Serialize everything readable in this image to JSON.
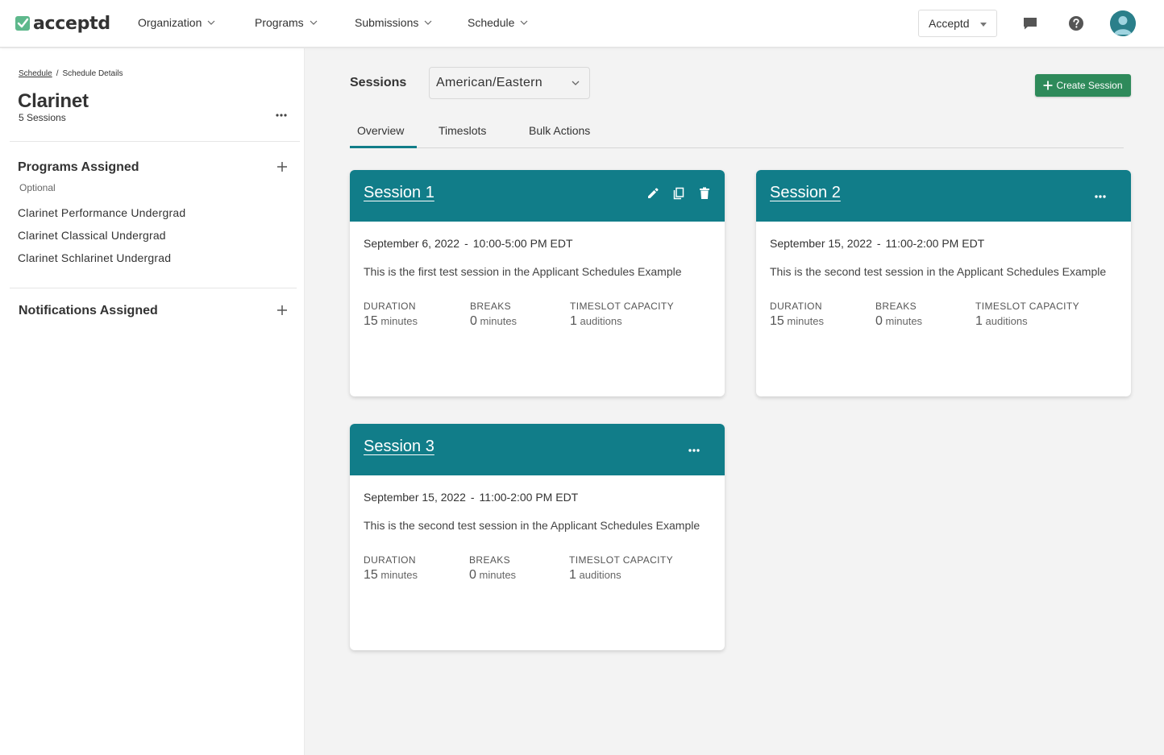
{
  "app": {
    "logo_text": "acceptd"
  },
  "nav": {
    "items": [
      {
        "label": "Organization"
      },
      {
        "label": "Programs"
      },
      {
        "label": "Submissions"
      },
      {
        "label": "Schedule"
      }
    ],
    "org_select": "Acceptd",
    "icons": [
      "chat-icon",
      "help-icon",
      "user-avatar-icon"
    ]
  },
  "sidebar": {
    "breadcrumb": {
      "link": "Schedule",
      "separator": "/",
      "current": "Schedule Details"
    },
    "title": "Clarinet",
    "subtitle": "5 Sessions",
    "programs": {
      "title": "Programs Assigned",
      "optional": "Optional",
      "items": [
        "Clarinet Performance Undergrad",
        "Clarinet Classical Undergrad",
        "Clarinet Schlarinet Undergrad"
      ]
    },
    "notifications": {
      "title": "Notifications Assigned"
    }
  },
  "main": {
    "sessions_label": "Sessions",
    "timezone": "American/Eastern",
    "create_button": "Create Session",
    "tabs": [
      {
        "label": "Overview",
        "active": true
      },
      {
        "label": "Timeslots",
        "active": false
      },
      {
        "label": "Bulk Actions",
        "active": false
      }
    ],
    "cards": [
      {
        "title": "Session 1",
        "date": "September 6, 2022",
        "separator": "-",
        "time": "10:00-5:00 PM EDT",
        "description": "This is the first test session in the Applicant Schedules Example",
        "duration_label": "DURATION",
        "duration_num": "15",
        "duration_unit": "minutes",
        "breaks_label": "BREAKS",
        "breaks_num": "0",
        "breaks_unit": "minutes",
        "capacity_label": "TIMESLOT CAPACITY",
        "capacity_num": "1",
        "capacity_unit": "auditions"
      },
      {
        "title": "Session 2",
        "date": "September 15, 2022",
        "separator": "-",
        "time": "11:00-2:00 PM EDT",
        "description": "This is the second test session in the Applicant Schedules Example",
        "duration_label": "DURATION",
        "duration_num": "15",
        "duration_unit": "minutes",
        "breaks_label": "BREAKS",
        "breaks_num": "0",
        "breaks_unit": "minutes",
        "capacity_label": "TIMESLOT CAPACITY",
        "capacity_num": "1",
        "capacity_unit": "auditions"
      },
      {
        "title": "Session 3",
        "date": "September 15, 2022",
        "separator": "-",
        "time": "11:00-2:00 PM EDT",
        "description": "This is the second test session in the Applicant Schedules Example",
        "duration_label": "DURATION",
        "duration_num": "15",
        "duration_unit": "minutes",
        "breaks_label": "BREAKS",
        "breaks_num": "0",
        "breaks_unit": "minutes",
        "capacity_label": "TIMESLOT CAPACITY",
        "capacity_num": "1",
        "capacity_unit": "auditions"
      }
    ]
  },
  "colors": {
    "brand_teal": "#117d89",
    "create_green": "#2e8a5a",
    "logo_green": "#5eb88c"
  }
}
